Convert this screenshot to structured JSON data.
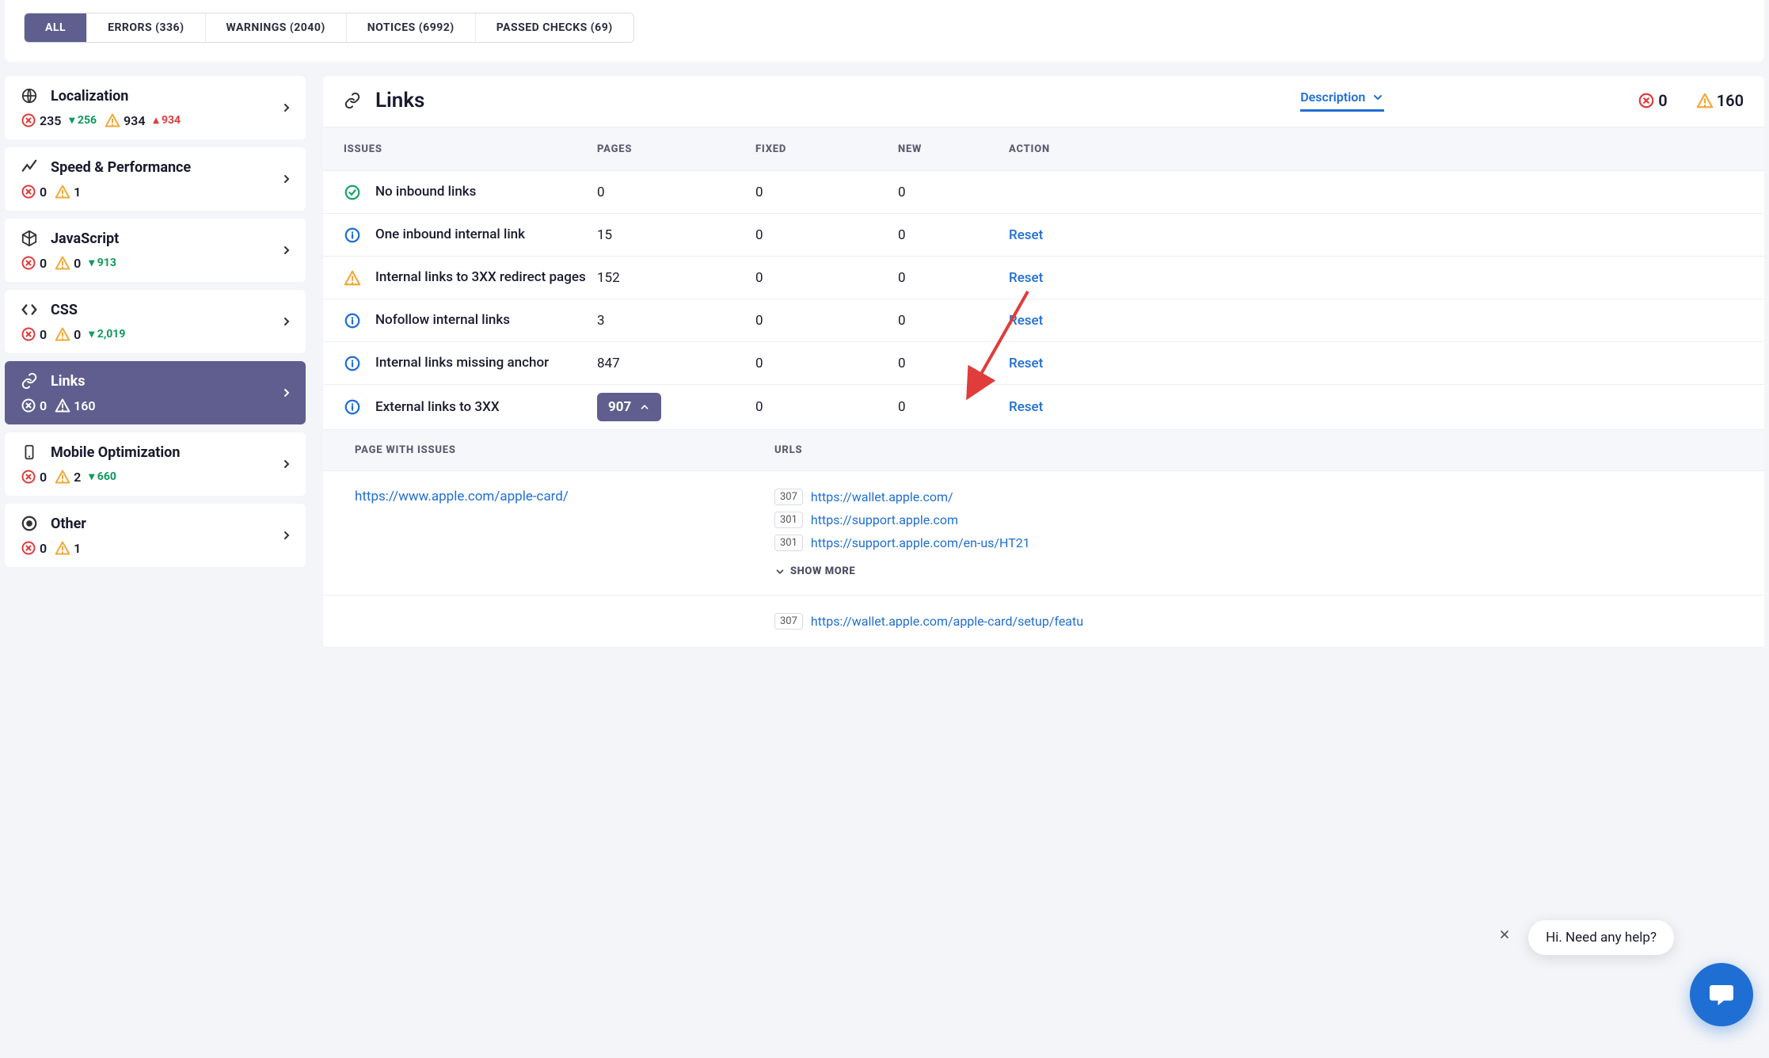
{
  "tabs": {
    "all": "ALL",
    "errors": "ERRORS (336)",
    "warnings": "WARNINGS (2040)",
    "notices": "NOTICES (6992)",
    "passed": "PASSED CHECKS (69)"
  },
  "sidebar": [
    {
      "id": "localization",
      "title": "Localization",
      "err": "235",
      "err_delta": "256",
      "err_dir": "down",
      "warn": "934",
      "warn_delta": "934",
      "warn_dir": "up"
    },
    {
      "id": "speed",
      "title": "Speed & Performance",
      "err": "0",
      "warn": "1"
    },
    {
      "id": "javascript",
      "title": "JavaScript",
      "err": "0",
      "warn": "0",
      "warn_delta": "913",
      "warn_dir": "down"
    },
    {
      "id": "css",
      "title": "CSS",
      "err": "0",
      "warn": "0",
      "warn_delta": "2,019",
      "warn_dir": "down"
    },
    {
      "id": "links",
      "title": "Links",
      "err": "0",
      "warn": "160",
      "active": true
    },
    {
      "id": "mobile",
      "title": "Mobile Optimization",
      "err": "0",
      "warn": "2",
      "warn_delta": "660",
      "warn_dir": "down"
    },
    {
      "id": "other",
      "title": "Other",
      "err": "0",
      "warn": "1"
    }
  ],
  "main": {
    "title": "Links",
    "desc_tab": "Description",
    "hdr_err": "0",
    "hdr_warn": "160",
    "columns": {
      "issues": "ISSUES",
      "pages": "PAGES",
      "fixed": "FIXED",
      "new": "NEW",
      "action": "ACTION"
    },
    "rows": [
      {
        "status": "ok",
        "issue": "No inbound links",
        "pages": "0",
        "fixed": "0",
        "new": "0",
        "action": ""
      },
      {
        "status": "info",
        "issue": "One inbound internal link",
        "pages": "15",
        "fixed": "0",
        "new": "0",
        "action": "Reset"
      },
      {
        "status": "warn",
        "issue": "Internal links to 3XX redirect pages",
        "pages": "152",
        "fixed": "0",
        "new": "0",
        "action": "Reset"
      },
      {
        "status": "info",
        "issue": "Nofollow internal links",
        "pages": "3",
        "fixed": "0",
        "new": "0",
        "action": "Reset"
      },
      {
        "status": "info",
        "issue": "Internal links missing anchor",
        "pages": "847",
        "fixed": "0",
        "new": "0",
        "action": "Reset"
      },
      {
        "status": "info",
        "issue": "External links to 3XX",
        "pages": "907",
        "fixed": "0",
        "new": "0",
        "action": "Reset",
        "expanded": true
      }
    ],
    "subhead": {
      "page": "PAGE WITH ISSUES",
      "urls": "URLS"
    },
    "detail": [
      {
        "page": "https://www.apple.com/apple-card/",
        "urls": [
          {
            "code": "307",
            "url": "https://wallet.apple.com/"
          },
          {
            "code": "301",
            "url": "https://support.apple.com"
          },
          {
            "code": "301",
            "url": "https://support.apple.com/en-us/HT21"
          }
        ],
        "show_more": "SHOW MORE"
      },
      {
        "page": "",
        "urls": [
          {
            "code": "307",
            "url": "https://wallet.apple.com/apple-card/setup/featu"
          }
        ]
      }
    ]
  },
  "chat": {
    "text": "Hi. Need any help?"
  }
}
